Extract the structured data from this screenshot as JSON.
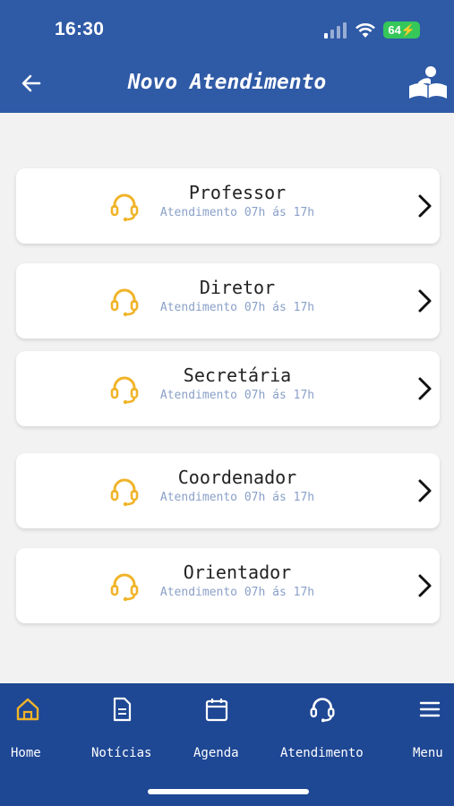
{
  "status_bar": {
    "time": "16:30",
    "battery": "64"
  },
  "header": {
    "title": "Novo Atendimento"
  },
  "contacts": [
    {
      "name": "Professor",
      "hours": "Atendimento 07h ás 17h"
    },
    {
      "name": "Diretor",
      "hours": "Atendimento 07h ás 17h"
    },
    {
      "name": "Secretária",
      "hours": "Atendimento 07h ás 17h"
    },
    {
      "name": "Coordenador",
      "hours": "Atendimento 07h ás 17h"
    },
    {
      "name": "Orientador",
      "hours": "Atendimento 07h ás 17h"
    }
  ],
  "bottom_nav": [
    {
      "label": "Home",
      "icon": "home-icon",
      "active": true
    },
    {
      "label": "Notícias",
      "icon": "document-icon"
    },
    {
      "label": "Agenda",
      "icon": "calendar-icon"
    },
    {
      "label": "Atendimento",
      "icon": "headset-icon"
    },
    {
      "label": "Menu",
      "icon": "menu-icon"
    }
  ],
  "colors": {
    "header": "#2f5aa6",
    "bottom_nav": "#1e4794",
    "accent_yellow": "#f0b429",
    "hours_text": "#8aa0c8",
    "battery": "#35c759"
  }
}
